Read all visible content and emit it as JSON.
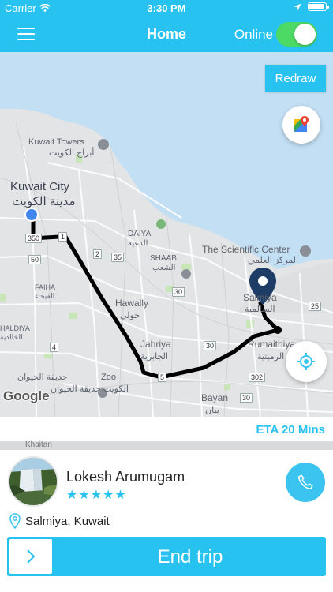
{
  "status_bar": {
    "carrier": "Carrier",
    "time": "3:30 PM",
    "battery_level": 1.0
  },
  "nav": {
    "menu_icon": "hamburger-menu-icon",
    "title": "Home",
    "online_label": "Online",
    "online_toggle_on": true
  },
  "map": {
    "redraw_label": "Redraw",
    "eta": "ETA 20 Mins",
    "attribution": "Google",
    "labels": {
      "kuwait_towers": "Kuwait Towers",
      "kuwait_towers_ar": "أبراج الكويت",
      "kuwait_city": "Kuwait City",
      "kuwait_city_ar": "مدينة الكويت",
      "daiya": "DAIYA",
      "daiya_ar": "الدعية",
      "shaab": "SHAAB",
      "shaab_ar": "الشعب",
      "scientific_center": "The Scientific Center",
      "scientific_center_ar": "المركز العلمي",
      "salmiya": "Salmiya",
      "salmiya_ar": "السالمية",
      "hawally": "Hawally",
      "hawally_ar": "حولي",
      "faiha": "FAIHA",
      "faiha_ar": "الفيحاء",
      "khaldiya": "HALDIYA",
      "khaldiya_ar": "الخالدية",
      "jabriya": "Jabriya",
      "jabriya_ar": "الجابرية",
      "rumaithiya": "Rumaithiya",
      "rumaithiya_ar": "الرميثية",
      "zoo": "Zoo",
      "zoo_ar": "حديقة الحيوان",
      "zoo_ar2": "الكويت حديقة الحيوان",
      "bayan": "Bayan",
      "bayan_ar": "بيان",
      "khaitan": "Khaitan"
    },
    "roads": [
      "350",
      "1",
      "50",
      "2",
      "35",
      "30",
      "4",
      "30",
      "30",
      "5",
      "302",
      "25",
      "30"
    ]
  },
  "driver": {
    "name": "Lokesh Arumugam",
    "rating": 5,
    "stars": "★★★★★",
    "location": "Salmiya, Kuwait"
  },
  "actions": {
    "end_trip": "End trip"
  },
  "colors": {
    "accent": "#27c2ef",
    "toggle_on": "#4cd964",
    "route": "#000000",
    "pin": "#1d3d66"
  }
}
